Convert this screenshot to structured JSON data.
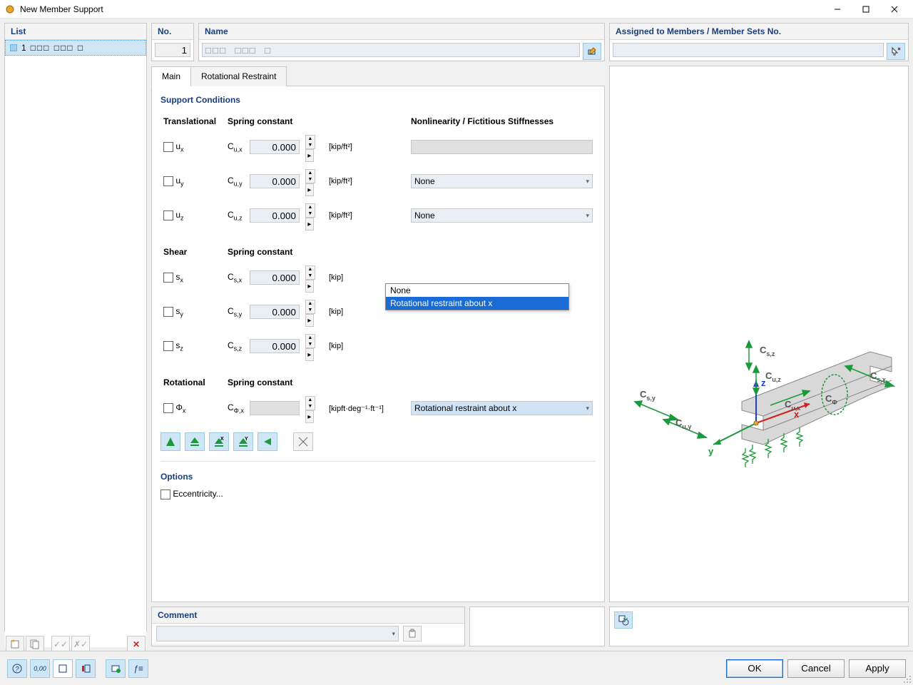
{
  "window": {
    "title": "New Member Support"
  },
  "left": {
    "head": "List",
    "item_no": "1",
    "item_label": "□□□  □□□  □"
  },
  "top": {
    "no_head": "No.",
    "no_value": "1",
    "name_head": "Name",
    "name_value": "□□□  □□□  □",
    "assigned_head": "Assigned to Members / Member Sets No."
  },
  "tabs": {
    "main": "Main",
    "rot": "Rotational Restraint"
  },
  "support": {
    "head": "Support Conditions",
    "translational": "Translational",
    "spring": "Spring constant",
    "nonlin": "Nonlinearity / Fictitious Stiffnesses",
    "ux": "uₓ",
    "uy": "uᵧ",
    "uz": "u𝓏",
    "Cux": "C",
    "Cuxs": "u,x",
    "Cuys": "u,y",
    "Cuzs": "u,z",
    "val": "0.000",
    "unit_kipft2": "[kip/ft²]",
    "sel_none": "None",
    "shear": "Shear",
    "sx": "sₓ",
    "sy": "sᵧ",
    "sz": "s𝓏",
    "Csxs": "s,x",
    "Csys": "s,y",
    "Cszs": "s,z",
    "unit_kip": "[kip]",
    "rotational": "Rotational",
    "phix": "Φₓ",
    "Cphixs": "Φ,x",
    "unit_rot": "[kipft·deg⁻¹·ft⁻¹]",
    "sel_rot": "Rotational restraint about x",
    "dd_opt0": "None",
    "dd_opt1": "Rotational restraint about x"
  },
  "options": {
    "head": "Options",
    "ecc": "Eccentricity..."
  },
  "comment": {
    "head": "Comment"
  },
  "diagram": {
    "Csz": "C",
    "Csz_s": "s,z",
    "Csy": "C",
    "Csy_s": "s,y",
    "Csx": "C",
    "Csx_s": "s,x",
    "Cuz": "C",
    "Cuz_s": "u,z",
    "Cuy": "C",
    "Cuy_s": "u,y",
    "Cux": "C",
    "Cux_s": "u,x",
    "Cphi": "C",
    "Cphi_s": "Φ",
    "x": "x",
    "y": "y",
    "z": "z"
  },
  "footer": {
    "ok": "OK",
    "cancel": "Cancel",
    "apply": "Apply"
  }
}
